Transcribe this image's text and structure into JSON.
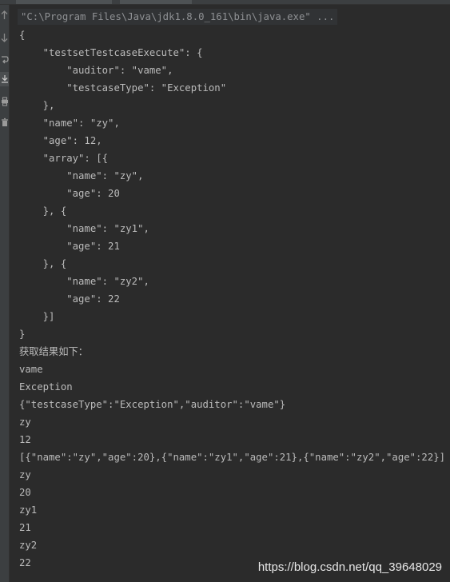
{
  "gutter": {
    "icons": [
      "arrow-up-icon",
      "arrow-down-icon",
      "soft-wrap-icon",
      "scroll-to-end-icon",
      "print-icon",
      "trash-icon"
    ]
  },
  "console": {
    "command": "\"C:\\Program Files\\Java\\jdk1.8.0_161\\bin\\java.exe\" ...",
    "lines": [
      "{",
      "    \"testsetTestcaseExecute\": {",
      "        \"auditor\": \"vame\",",
      "        \"testcaseType\": \"Exception\"",
      "    },",
      "    \"name\": \"zy\",",
      "    \"age\": 12,",
      "    \"array\": [{",
      "        \"name\": \"zy\",",
      "        \"age\": 20",
      "    }, {",
      "        \"name\": \"zy1\",",
      "        \"age\": 21",
      "    }, {",
      "        \"name\": \"zy2\",",
      "        \"age\": 22",
      "    }]",
      "}",
      "获取结果如下：",
      "vame",
      "Exception",
      "{\"testcaseType\":\"Exception\",\"auditor\":\"vame\"}",
      "zy",
      "12",
      "[{\"name\":\"zy\",\"age\":20},{\"name\":\"zy1\",\"age\":21},{\"name\":\"zy2\",\"age\":22}]",
      "zy",
      "20",
      "zy1",
      "21",
      "zy2",
      "22"
    ]
  },
  "watermark": "https://blog.csdn.net/qq_39648029"
}
